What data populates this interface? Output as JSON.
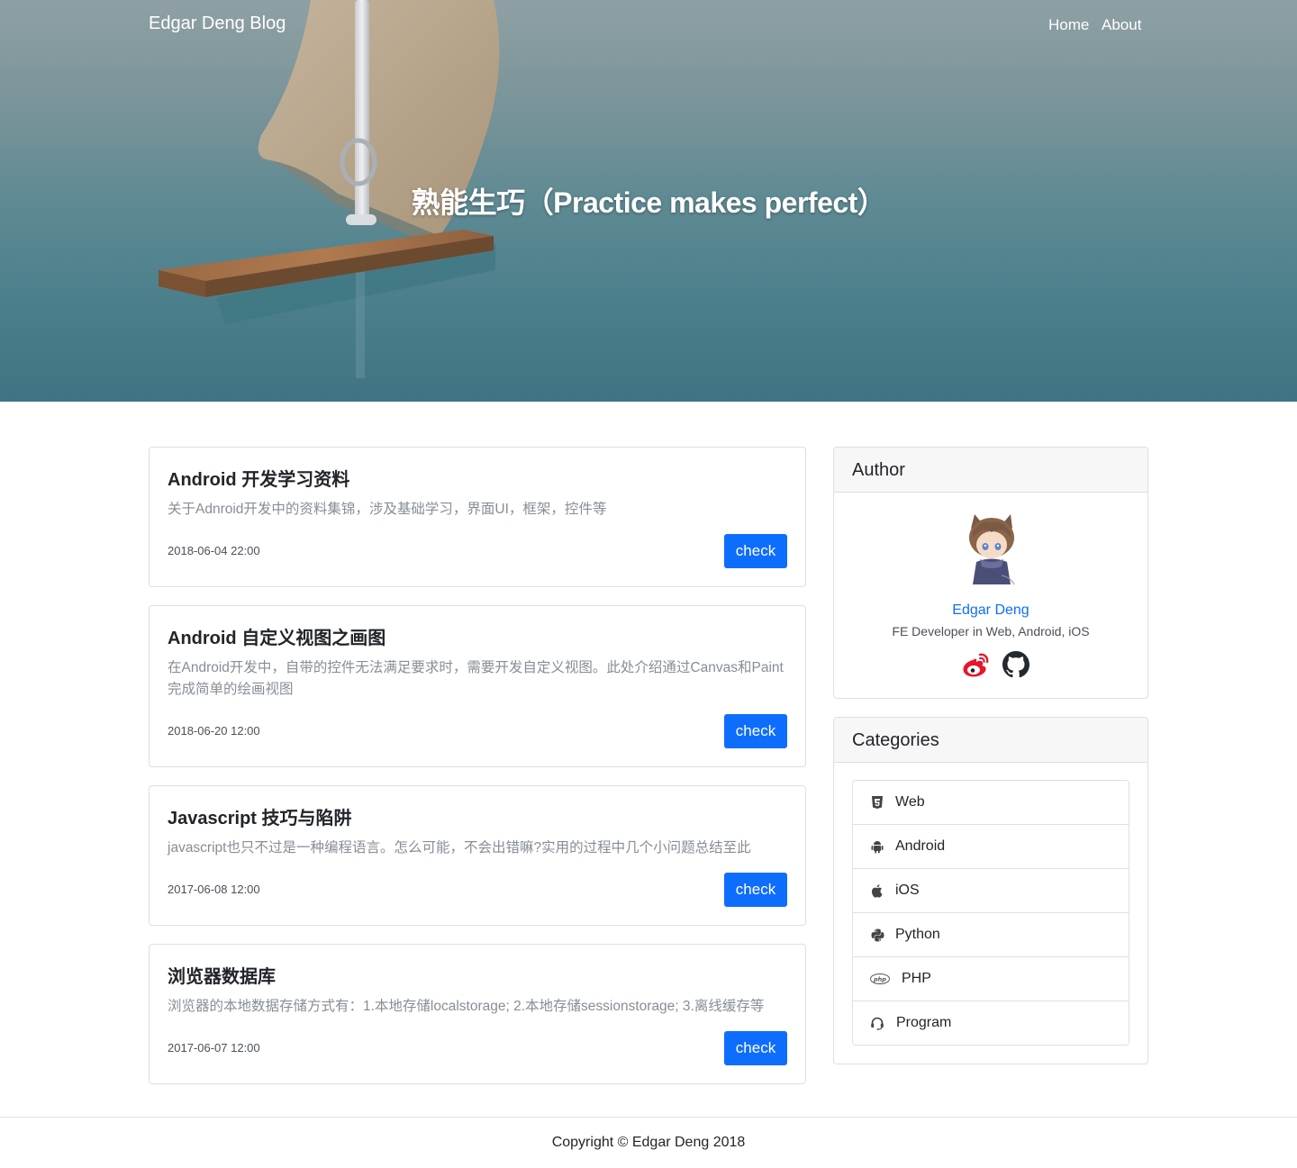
{
  "nav": {
    "brand": "Edgar Deng Blog",
    "links": [
      "Home",
      "About"
    ]
  },
  "hero": {
    "title": "熟能生巧（Practice makes perfect）"
  },
  "posts": [
    {
      "title": "Android 开发学习资料",
      "description": "关于Adnroid开发中的资料集锦，涉及基础学习，界面UI，框架，控件等",
      "date": "2018-06-04 22:00",
      "button": "check"
    },
    {
      "title": "Android 自定义视图之画图",
      "description": "在Android开发中，自带的控件无法满足要求时，需要开发自定义视图。此处介绍通过Canvas和Paint完成简单的绘画视图",
      "date": "2018-06-20 12:00",
      "button": "check"
    },
    {
      "title": "Javascript 技巧与陷阱",
      "description": "javascript也只不过是一种编程语言。怎么可能，不会出错嘛?实用的过程中几个小问题总结至此",
      "date": "2017-06-08 12:00",
      "button": "check"
    },
    {
      "title": "浏览器数据库",
      "description": "浏览器的本地数据存储方式有：1.本地存储localstorage; 2.本地存储sessionstorage; 3.离线缓存等",
      "date": "2017-06-07 12:00",
      "button": "check"
    }
  ],
  "author": {
    "header": "Author",
    "name": "Edgar Deng",
    "bio": "FE Developer in Web, Android, iOS",
    "social": [
      "weibo-icon",
      "github-icon"
    ]
  },
  "categories": {
    "header": "Categories",
    "items": [
      {
        "label": "Web",
        "icon": "html5-icon"
      },
      {
        "label": "Android",
        "icon": "android-icon"
      },
      {
        "label": "iOS",
        "icon": "apple-icon"
      },
      {
        "label": "Python",
        "icon": "python-icon"
      },
      {
        "label": "PHP",
        "icon": "php-icon"
      },
      {
        "label": "Program",
        "icon": "headset-icon"
      }
    ]
  },
  "footer": {
    "copyright": "Copyright © Edgar Deng 2018"
  },
  "colors": {
    "primary": "#0d6efd",
    "weibo": "#e6162d",
    "github": "#24292e",
    "muted": "#868e96"
  }
}
